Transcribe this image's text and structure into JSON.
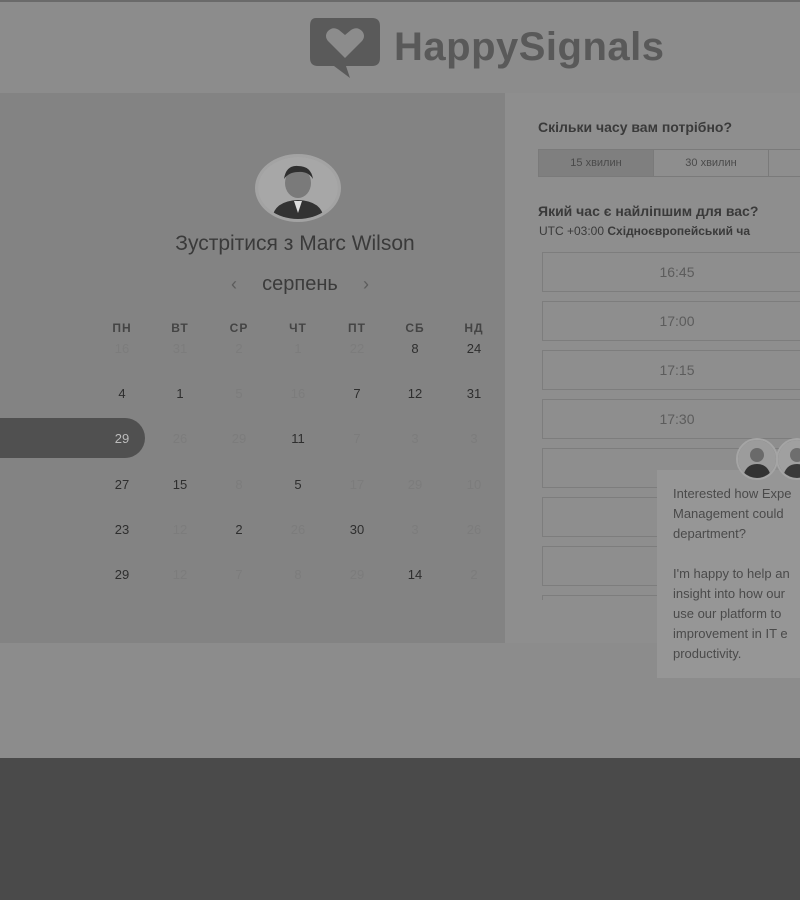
{
  "logo": {
    "brand": "HappySignals",
    "icon": "heart-chat-icon"
  },
  "host": {
    "title": "Зустрітися з Marc Wilson",
    "avatar": "host-avatar"
  },
  "calendar": {
    "month": "серпень",
    "prev_icon": "chevron-left-icon",
    "next_icon": "chevron-right-icon",
    "weekdays": [
      "ПН",
      "ВТ",
      "СР",
      "ЧТ",
      "ПТ",
      "СБ",
      "НД"
    ],
    "weeks": [
      [
        {
          "d": "16",
          "a": false
        },
        {
          "d": "31",
          "a": false
        },
        {
          "d": "2",
          "a": false
        },
        {
          "d": "1",
          "a": false
        },
        {
          "d": "22",
          "a": false
        },
        {
          "d": "8",
          "a": true
        },
        {
          "d": "24",
          "a": true
        }
      ],
      [
        {
          "d": "4",
          "a": true
        },
        {
          "d": "1",
          "a": true
        },
        {
          "d": "5",
          "a": false
        },
        {
          "d": "16",
          "a": false
        },
        {
          "d": "7",
          "a": true
        },
        {
          "d": "12",
          "a": true
        },
        {
          "d": "31",
          "a": true
        }
      ],
      [
        {
          "d": "29",
          "a": true,
          "sel": true
        },
        {
          "d": "26",
          "a": false
        },
        {
          "d": "29",
          "a": false
        },
        {
          "d": "11",
          "a": true
        },
        {
          "d": "7",
          "a": false
        },
        {
          "d": "3",
          "a": false
        },
        {
          "d": "3",
          "a": false
        }
      ],
      [
        {
          "d": "27",
          "a": true
        },
        {
          "d": "15",
          "a": true
        },
        {
          "d": "8",
          "a": false
        },
        {
          "d": "5",
          "a": true
        },
        {
          "d": "17",
          "a": false
        },
        {
          "d": "29",
          "a": false
        },
        {
          "d": "10",
          "a": false
        }
      ],
      [
        {
          "d": "23",
          "a": true
        },
        {
          "d": "12",
          "a": false
        },
        {
          "d": "2",
          "a": true
        },
        {
          "d": "26",
          "a": false
        },
        {
          "d": "30",
          "a": true
        },
        {
          "d": "3",
          "a": false
        },
        {
          "d": "26",
          "a": false
        }
      ],
      [
        {
          "d": "29",
          "a": true
        },
        {
          "d": "12",
          "a": false
        },
        {
          "d": "7",
          "a": false
        },
        {
          "d": "8",
          "a": false
        },
        {
          "d": "29",
          "a": false
        },
        {
          "d": "14",
          "a": true
        },
        {
          "d": "2",
          "a": false
        }
      ]
    ]
  },
  "booking": {
    "duration_question": "Скільки часу вам потрібно?",
    "durations": [
      {
        "label": "15 хвилин",
        "active": true
      },
      {
        "label": "30 хвилин",
        "active": false
      },
      {
        "label": "",
        "active": false
      }
    ],
    "time_question": "Який час є найліпшим для вас?",
    "timezone_prefix": "UTC +03:00",
    "timezone_name": "Східноєвропейський ча",
    "slots": [
      "16:45",
      "17:00",
      "17:15",
      "17:30",
      "",
      "",
      "",
      ""
    ]
  },
  "chat": {
    "message": "Interested how Expe\nManagement could\ndepartment?\n\nI'm happy to help an\ninsight into how our\nuse our platform to\nimprovement in IT e\nproductivity."
  }
}
